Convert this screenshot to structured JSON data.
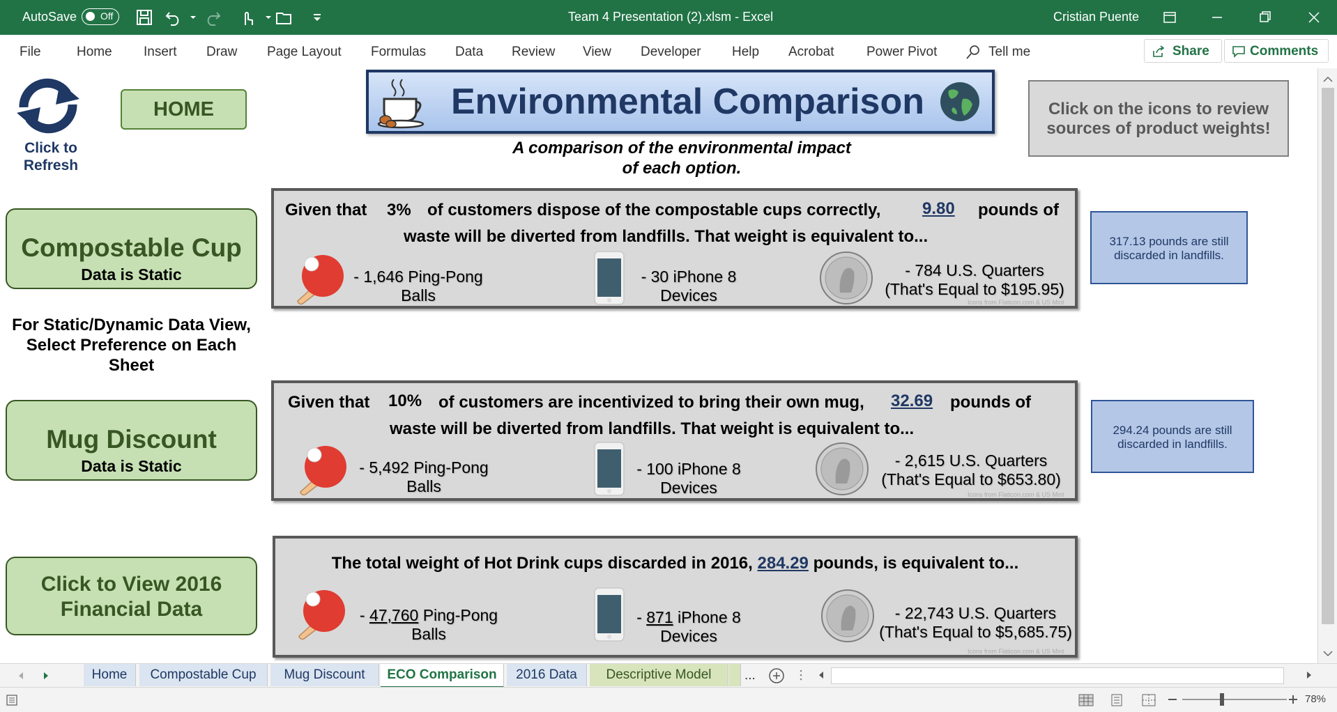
{
  "titlebar": {
    "autosave_label": "AutoSave",
    "autosave_state": "Off",
    "document_title": "Team 4 Presentation (2).xlsm  -  Excel",
    "user_name": "Cristian Puente",
    "accent_color": "#217346"
  },
  "menu": {
    "items": [
      "File",
      "Home",
      "Insert",
      "Draw",
      "Page Layout",
      "Formulas",
      "Data",
      "Review",
      "View",
      "Developer",
      "Help",
      "Acrobat",
      "Power Pivot"
    ],
    "tell_me": "Tell me",
    "share": "Share",
    "comments": "Comments"
  },
  "sheet": {
    "refresh_label_1": "Click to",
    "refresh_label_2": "Refresh",
    "home_button": "HOME",
    "banner_title": "Environmental Comparison",
    "subtitle_line1": "A comparison of the environmental impact",
    "subtitle_line2": "of each option.",
    "icons_note": "Click on the icons to review sources of product weights!",
    "compostable": {
      "title": "Compostable Cup",
      "status": "Data is Static"
    },
    "static_note": "For Static/Dynamic Data View, Select Preference on Each Sheet",
    "mug": {
      "title": "Mug Discount",
      "status": "Data is Static"
    },
    "financial_button": "Click to View 2016 Financial Data",
    "panel1": {
      "l1_a": "Given that",
      "pct": "3%",
      "l1_b": "of customers dispose of the compostable cups correctly,",
      "weight": "9.80",
      "l1_c": "pounds of",
      "l2": "waste will be diverted from landfills. That weight is equivalent to...",
      "pingpong": "- 1,646 Ping-Pong",
      "pingpong_2": "Balls",
      "iphone": "- 30 iPhone 8",
      "iphone_2": "Devices",
      "quarters": "- 784 U.S. Quarters",
      "quarters_2": "(That's Equal to $195.95)",
      "credit": "Icons from Flaticon.com & US Mint"
    },
    "panel2": {
      "l1_a": "Given that",
      "pct": "10%",
      "l1_b": "of customers are incentivized to bring their own mug,",
      "weight": "32.69",
      "l1_c": "pounds of",
      "l2": "waste will be diverted from landfills. That weight is equivalent to...",
      "pingpong": "- 5,492 Ping-Pong",
      "pingpong_2": "Balls",
      "iphone": "- 100 iPhone 8",
      "iphone_2": "Devices",
      "quarters": "- 2,615 U.S. Quarters",
      "quarters_2": "(That's Equal to $653.80)",
      "credit": "Icons from Flaticon.com & US Mint"
    },
    "panel3": {
      "l1_a": "The total weight of Hot Drink cups discarded in 2016,",
      "weight": "284.29",
      "l1_b": "pounds, is equivalent to...",
      "pingpong_dash": "-",
      "pingpong_num": "47,760",
      "pingpong_rest": "Ping-Pong",
      "pingpong_2": "Balls",
      "iphone_dash": "-",
      "iphone_num": "871",
      "iphone_rest": "iPhone 8",
      "iphone_2": "Devices",
      "quarters": "- 22,743 U.S. Quarters",
      "quarters_2": "(That's Equal to $5,685.75)",
      "credit": "Icons from Flaticon.com & US Mint"
    },
    "note1": "317.13 pounds are still discarded in landfills.",
    "note2": "294.24 pounds are still discarded in landfills."
  },
  "tabs": [
    "Home",
    "Compostable Cup",
    "Mug Discount",
    "ECO Comparison",
    "2016 Data",
    "Descriptive Model"
  ],
  "tabs_more": "...",
  "status": {
    "zoom": "78%"
  }
}
